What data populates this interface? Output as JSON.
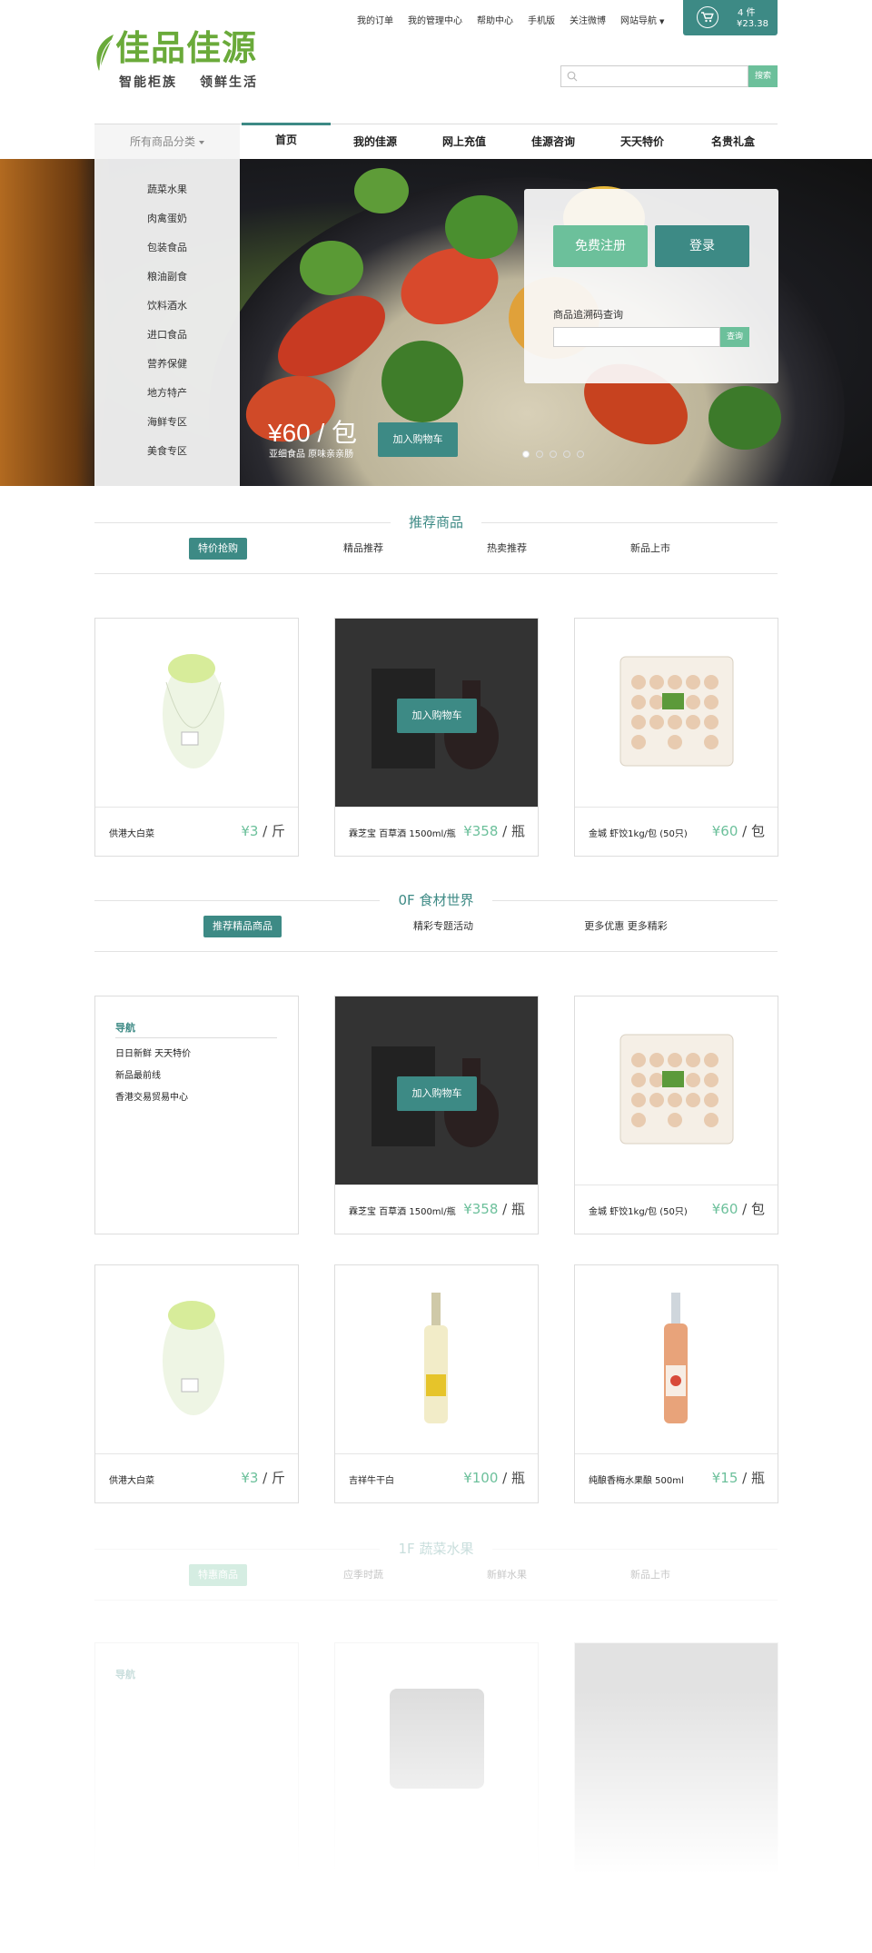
{
  "top_links": [
    "我的订单",
    "我的管理中心",
    "帮助中心",
    "手机版",
    "关注微博",
    "网站导航"
  ],
  "cart": {
    "count": "4 件",
    "total": "¥23.38"
  },
  "logo": {
    "main": "佳品佳源",
    "sub1": "智能柜族",
    "sub2": "领鲜生活"
  },
  "search": {
    "placeholder": "",
    "button": "搜索"
  },
  "nav": {
    "category_label": "所有商品分类",
    "items": [
      "首页",
      "我的佳源",
      "网上充值",
      "佳源咨询",
      "天天特价",
      "名贵礼盒"
    ]
  },
  "side_menu": [
    "蔬菜水果",
    "肉禽蛋奶",
    "包装食品",
    "粮油副食",
    "饮料酒水",
    "进口食品",
    "营养保健",
    "地方特产",
    "海鲜专区",
    "美食专区"
  ],
  "login_panel": {
    "register": "免费注册",
    "login": "登录",
    "trace_label": "商品追溯码查询",
    "trace_button": "查询"
  },
  "promo": {
    "price": "¥60 / 包",
    "desc": "亚细食品 原味亲亲肠",
    "button": "加入购物车"
  },
  "recommend": {
    "title": "推荐商品",
    "tabs": [
      "特价抢购",
      "精品推荐",
      "热卖推荐",
      "新品上市"
    ],
    "products": [
      {
        "name": "供港大白菜",
        "price": "¥3",
        "unit": " / 斤"
      },
      {
        "name": "霖芝宝 百草酒 1500ml/瓶",
        "price": "¥358",
        "unit": " / 瓶",
        "cart": "加入购物车"
      },
      {
        "name": "金城 虾饺1kg/包 (50只)",
        "price": "¥60",
        "unit": " / 包"
      }
    ]
  },
  "floor0": {
    "title": "0F  食材世界",
    "tabs": [
      "推荐精品商品",
      "精彩专题活动",
      "更多优惠 更多精彩"
    ],
    "nav_title": "导航",
    "nav_items": [
      "日日新鲜  天天特价",
      "新品最前线",
      "香港交易贸易中心"
    ],
    "products": [
      {
        "name": "霖芝宝 百草酒 1500ml/瓶",
        "price": "¥358",
        "unit": " / 瓶",
        "cart": "加入购物车"
      },
      {
        "name": "金城 虾饺1kg/包 (50只)",
        "price": "¥60",
        "unit": " / 包"
      },
      {
        "name": "供港大白菜",
        "price": "¥3",
        "unit": " / 斤"
      },
      {
        "name": "吉祥牛干白",
        "price": "¥100",
        "unit": " / 瓶"
      },
      {
        "name": "纯酿香梅水果酿 500ml",
        "price": "¥15",
        "unit": " / 瓶"
      }
    ]
  },
  "floor1": {
    "title": "1F  蔬菜水果",
    "tabs": [
      "特惠商品",
      "应季时蔬",
      "新鲜水果",
      "新品上市"
    ],
    "nav_title": "导航"
  },
  "colors": {
    "accent": "#3d8a85",
    "accent_light": "#6cc09b",
    "logo_green": "#6aaa3a"
  }
}
